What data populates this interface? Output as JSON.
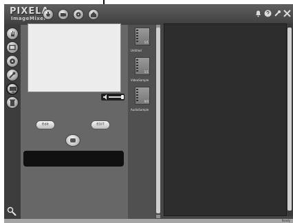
{
  "app": {
    "logo_line1": "PIXELA",
    "logo_line2": "ImageMixer"
  },
  "toolbar": {
    "buttons": [
      {
        "icon": "import-icon"
      },
      {
        "icon": "camera-icon"
      },
      {
        "icon": "disc-icon"
      },
      {
        "icon": "home-icon"
      }
    ],
    "system_buttons": [
      {
        "icon": "bell-icon"
      },
      {
        "icon": "help-icon"
      },
      {
        "icon": "tool-icon"
      },
      {
        "icon": "close-icon"
      }
    ]
  },
  "sidebar": {
    "buttons": [
      {
        "icon": "hand-icon"
      },
      {
        "icon": "video-icon"
      },
      {
        "icon": "disc-icon"
      },
      {
        "icon": "wrench-icon"
      },
      {
        "icon": "monitor-icon"
      },
      {
        "icon": "trash-icon"
      }
    ],
    "bottom_icon": "magnifier-icon"
  },
  "preview": {
    "left_button_label": "Edit",
    "right_button_label": "EDIT"
  },
  "media": {
    "items": [
      {
        "label": "Untitled",
        "count": "1/1"
      },
      {
        "label": "VideoSample",
        "count": "1/1"
      },
      {
        "label": "AudioSample",
        "count": "0/0"
      }
    ]
  },
  "status": {
    "text": "Ready"
  },
  "colors": {
    "panel": "#676767",
    "timeline": "#2d2d2d",
    "preview": "#ececec",
    "display_bar": "#101010"
  }
}
